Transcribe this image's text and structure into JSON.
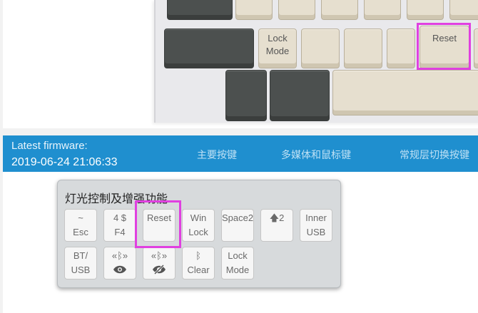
{
  "keyboard_photo": {
    "keys": {
      "lock_mode": [
        "Lock",
        "Mode"
      ],
      "reset": "Reset"
    }
  },
  "firmware_bar": {
    "label": "Latest firmware:",
    "date": "2019-06-24 21:06:33",
    "nav": [
      "主要按键",
      "多媒体和鼠标键",
      "常规层切换按键"
    ]
  },
  "popup": {
    "title": "灯光控制及增强功能",
    "buttons": [
      {
        "l1": "~",
        "l2": "Esc"
      },
      {
        "l1": "4 $",
        "l2": "F4"
      },
      {
        "l1": "Reset",
        "l2": ""
      },
      {
        "l1": "Win",
        "l2": "Lock"
      },
      {
        "l1": "Space2",
        "l2": ""
      },
      {
        "l1": "2",
        "icon": "arrow-up-icon",
        "l2": ""
      },
      {
        "l1": "Inner",
        "l2": "USB"
      },
      {
        "l1": "BT/",
        "l2": "USB"
      },
      {
        "icon_top": "bluetooth-signal-icon",
        "icon_bottom": "eye-icon"
      },
      {
        "icon_top": "bluetooth-signal-icon",
        "icon_bottom": "eye-slash-icon"
      },
      {
        "icon_top": "bluetooth-icon",
        "l2": "Clear"
      },
      {
        "l1": "Lock",
        "l2": "Mode"
      }
    ]
  },
  "colors": {
    "accent_bar": "#1f8fcf",
    "highlight": "#e040e0",
    "popup_bg": "#d7dadc"
  }
}
